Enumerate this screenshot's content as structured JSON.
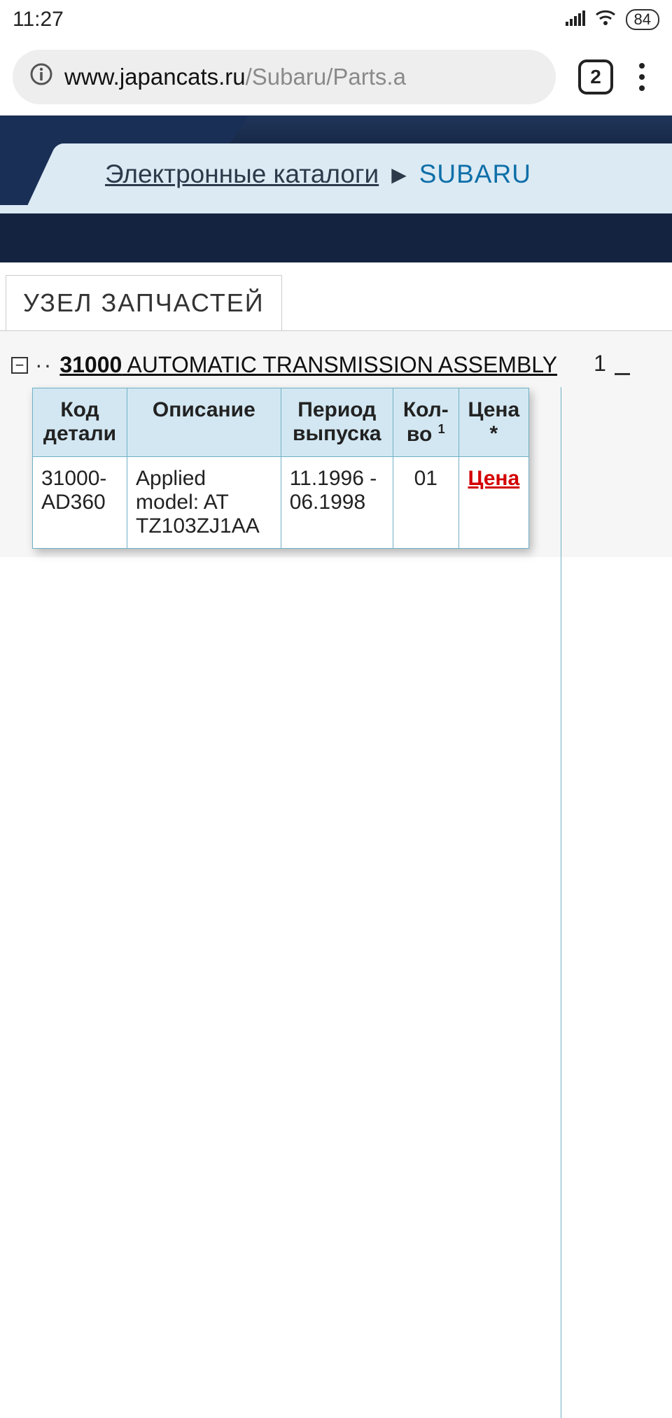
{
  "status": {
    "time": "11:27",
    "battery": "84"
  },
  "browser": {
    "url_domain": "www.japancats.ru",
    "url_path": "/Subaru/Parts.a",
    "tab_count": "2"
  },
  "breadcrumb": {
    "root": "Электронные каталоги",
    "current": "SUBARU"
  },
  "page_tab_title": "УЗЕЛ ЗАПЧАСТЕЙ",
  "tree": {
    "code": "31000",
    "name": "AUTOMATIC TRANSMISSION ASSEMBLY",
    "ref": "1"
  },
  "table": {
    "headers": {
      "code": "Код детали",
      "desc": "Описание",
      "period": "Период выпуска",
      "qty": "Кол-во",
      "qty_sup": "1",
      "price": "Цена *"
    },
    "rows": [
      {
        "code": "31000-AD360",
        "desc": "Applied model: AT TZ103ZJ1AA",
        "period": "11.1996 - 06.1998",
        "qty": "01",
        "price": "Цена"
      }
    ]
  }
}
